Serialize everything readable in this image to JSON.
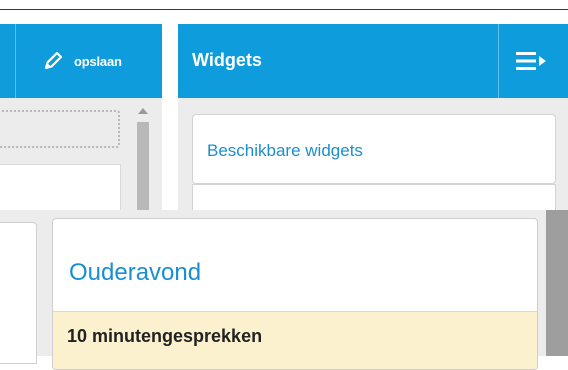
{
  "toolbar": {
    "save_label": "opslaan"
  },
  "widgets": {
    "title": "Widgets",
    "available_label": "Beschikbare widgets"
  },
  "card": {
    "title": "Ouderavond",
    "item_label": "10 minutengesprekken"
  },
  "colors": {
    "accent_blue": "#0e9cdc",
    "link_blue": "#1a8fd0",
    "highlight_yellow": "#fbf1cf",
    "panel_gray": "#ececec"
  },
  "icons": {
    "save": "pencil-icon",
    "menu": "hamburger-arrow-icon"
  }
}
